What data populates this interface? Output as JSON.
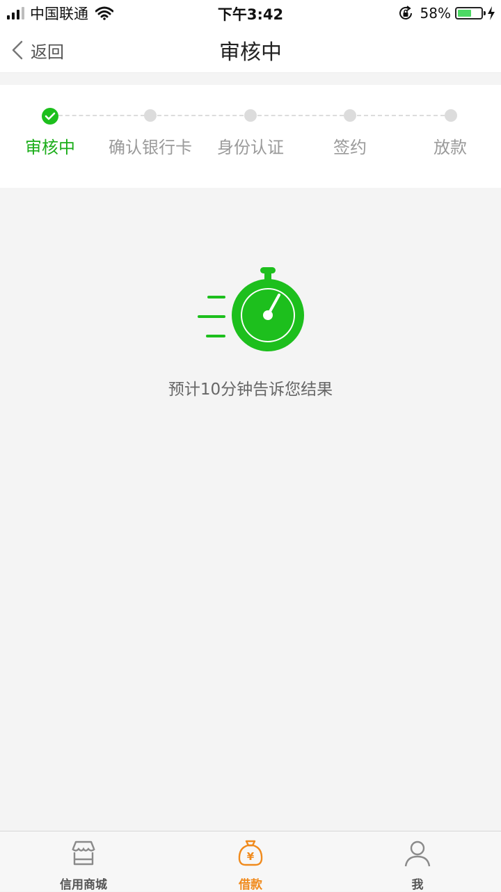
{
  "status_bar": {
    "carrier": "中国联通",
    "time": "下午3:42",
    "battery_percent": "58%",
    "battery_level": 0.58
  },
  "nav": {
    "back_label": "返回",
    "title": "审核中"
  },
  "stepper": {
    "active_index": 0,
    "steps": [
      {
        "label": "审核中"
      },
      {
        "label": "确认银行卡"
      },
      {
        "label": "身份认证"
      },
      {
        "label": "签约"
      },
      {
        "label": "放款"
      }
    ]
  },
  "content": {
    "icon": "stopwatch-icon",
    "eta_text": "预计10分钟告诉您结果"
  },
  "tabbar": {
    "items": [
      {
        "label": "信用商城",
        "icon": "store-icon",
        "active": false
      },
      {
        "label": "借款",
        "icon": "money-bag-icon",
        "active": true
      },
      {
        "label": "我",
        "icon": "user-icon",
        "active": false
      }
    ]
  },
  "colors": {
    "accent_green": "#1aad19",
    "accent_orange": "#f08a1c",
    "inactive_gray": "#9a9a9a",
    "battery_green": "#4cd964"
  }
}
